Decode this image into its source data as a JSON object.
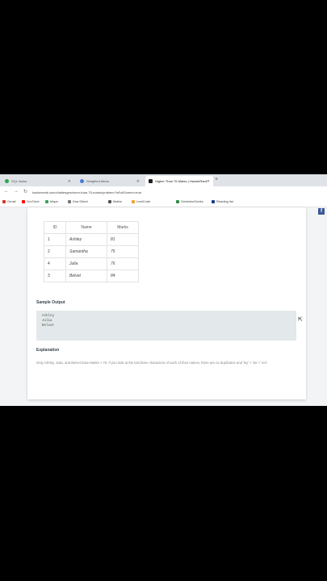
{
  "browser": {
    "tabs": [
      {
        "label": "SQL Notes",
        "color": "#2aa84a",
        "active": false
      },
      {
        "label": "Weighted Mean",
        "color": "#4a7bd8",
        "active": false
      },
      {
        "label": "Higher Than 75 Marks | HackerRank",
        "color": "#222222",
        "active": true
      }
    ],
    "new_tab": "+",
    "nav": {
      "back": "←",
      "forward": "→",
      "reload": "↻"
    },
    "url": "hackerrank.com/challenges/more-than-75-marks/problem?isFullScreen=true",
    "bookmarks": [
      {
        "label": "Gmail",
        "color": "#d93025"
      },
      {
        "label": "YouTube",
        "color": "#ff0000"
      },
      {
        "label": "Maps",
        "color": "#34a853"
      },
      {
        "label": "Dsa Sheet",
        "color": "#777777"
      },
      {
        "label": "Maths",
        "color": "#555555"
      },
      {
        "label": "LeetCode",
        "color": "#f0a030"
      },
      {
        "label": "GeeksforGeeks",
        "color": "#2f8d46"
      },
      {
        "label": "Reading list",
        "color": "#1a3a8f"
      }
    ]
  },
  "table": {
    "headers": [
      "ID",
      "Name",
      "Marks"
    ],
    "rows": [
      [
        "1",
        "Ashley",
        "81"
      ],
      [
        "2",
        "Samantha",
        "75"
      ],
      [
        "4",
        "Julia",
        "76"
      ],
      [
        "3",
        "Belvet",
        "84"
      ]
    ]
  },
  "sample_output": {
    "title": "Sample Output",
    "lines": [
      "Ashley",
      "Julia",
      "Belvet"
    ]
  },
  "explanation": {
    "title": "Explanation",
    "text": "Only Ashley, Julia, and Belvet have Marks > 75. If you look at the last three characters of each of their names, there are no duplicates and 'ley' < 'lia' < 'vet'."
  },
  "facebook_icon": "f"
}
